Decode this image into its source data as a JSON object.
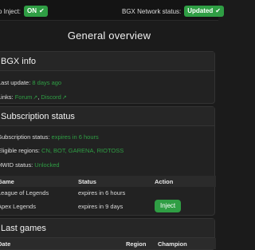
{
  "topbar": {
    "inject_label": "o Inject:",
    "inject_status": "ON",
    "network_label": "BGX Network status:",
    "network_status": "Updated"
  },
  "page": {
    "title": "General overview"
  },
  "bgx_info": {
    "title": "BGX info",
    "last_update_label": "Last update:",
    "last_update_value": "8 days ago",
    "links_label": "Links:",
    "links": [
      {
        "label": "Forum"
      },
      {
        "label": "Discord"
      }
    ]
  },
  "subscription": {
    "title": "Subscription status",
    "status_label": "Subscription status:",
    "status_value": "expires in 6 hours",
    "regions_label": "Eligible regions:",
    "regions_value": "CN, BOT, GARENA, RIOTOSS",
    "hwid_label": "HWID status:",
    "hwid_value": "Unlocked",
    "table": {
      "headers": [
        "Game",
        "Status",
        "Action"
      ],
      "rows": [
        {
          "game": "League of Legends",
          "status": "expires in 6 hours",
          "action": ""
        },
        {
          "game": "Apex Legends",
          "status": "expires in 9 days",
          "action": "Inject"
        }
      ]
    }
  },
  "last_games": {
    "title": "Last games",
    "headers": [
      "Date",
      "Region",
      "Champion"
    ]
  },
  "colors": {
    "accent": "#2f9e44",
    "background": "#1b1b1b",
    "card": "#222222"
  }
}
